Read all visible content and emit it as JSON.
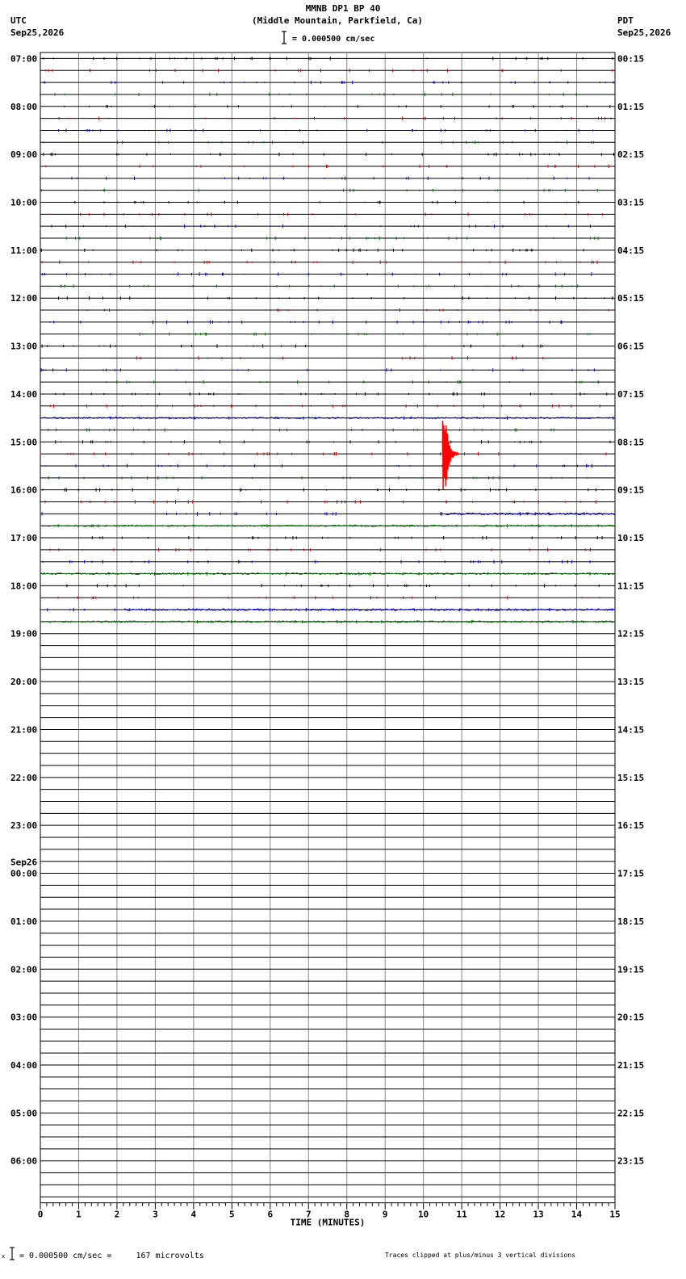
{
  "header": {
    "title": "MMNB DP1 BP 40",
    "subtitle": "(Middle Mountain, Parkfield, Ca)",
    "scale_label": "= 0.000500 cm/sec",
    "left_tz": "UTC",
    "left_date": "Sep25,2026",
    "right_tz": "PDT",
    "right_date": "Sep25,2026"
  },
  "footer": {
    "scale_note": "= 0.000500 cm/sec =     167 microvolts",
    "clip_note": "Traces clipped at plus/minus 3 vertical divisions"
  },
  "chart_data": {
    "type": "line",
    "title": "MMNB DP1 BP 40",
    "xlabel": "TIME (MINUTES)",
    "xlim": [
      0,
      15
    ],
    "x_ticks": [
      "0",
      "1",
      "2",
      "3",
      "4",
      "5",
      "6",
      "7",
      "8",
      "9",
      "10",
      "11",
      "12",
      "13",
      "14",
      "15"
    ],
    "traces_per_hour": 4,
    "total_traces": 96,
    "active_traces": 48,
    "trace_colors": [
      "#000000",
      "#cc0000",
      "#0000cc",
      "#007700"
    ],
    "left_labels": [
      {
        "trace": 0,
        "text": "07:00"
      },
      {
        "trace": 4,
        "text": "08:00"
      },
      {
        "trace": 8,
        "text": "09:00"
      },
      {
        "trace": 12,
        "text": "10:00"
      },
      {
        "trace": 16,
        "text": "11:00"
      },
      {
        "trace": 20,
        "text": "12:00"
      },
      {
        "trace": 24,
        "text": "13:00"
      },
      {
        "trace": 28,
        "text": "14:00"
      },
      {
        "trace": 32,
        "text": "15:00"
      },
      {
        "trace": 36,
        "text": "16:00"
      },
      {
        "trace": 40,
        "text": "17:00"
      },
      {
        "trace": 44,
        "text": "18:00"
      },
      {
        "trace": 48,
        "text": "19:00"
      },
      {
        "trace": 52,
        "text": "20:00"
      },
      {
        "trace": 56,
        "text": "21:00"
      },
      {
        "trace": 60,
        "text": "22:00"
      },
      {
        "trace": 64,
        "text": "23:00"
      },
      {
        "trace": 68,
        "text": "00:00",
        "date": "Sep26"
      },
      {
        "trace": 72,
        "text": "01:00"
      },
      {
        "trace": 76,
        "text": "02:00"
      },
      {
        "trace": 80,
        "text": "03:00"
      },
      {
        "trace": 84,
        "text": "04:00"
      },
      {
        "trace": 88,
        "text": "05:00"
      },
      {
        "trace": 92,
        "text": "06:00"
      }
    ],
    "right_labels": [
      "00:15",
      "01:15",
      "02:15",
      "03:15",
      "04:15",
      "05:15",
      "06:15",
      "07:15",
      "08:15",
      "09:15",
      "10:15",
      "11:15",
      "12:15",
      "13:15",
      "14:15",
      "15:15",
      "16:15",
      "17:15",
      "18:15",
      "19:15",
      "20:15",
      "21:15",
      "22:15",
      "23:15"
    ],
    "noisy_traces": [
      {
        "trace": 30,
        "start_min": 0,
        "level": 0.8
      },
      {
        "trace": 38,
        "start_min": 10.6,
        "level": 1.2
      },
      {
        "trace": 39,
        "start_min": 0,
        "level": 0.9
      },
      {
        "trace": 43,
        "start_min": 0,
        "level": 1.0
      },
      {
        "trace": 46,
        "start_min": 2.2,
        "level": 1.1
      },
      {
        "trace": 47,
        "start_min": 0,
        "level": 1.0
      }
    ],
    "events": [
      {
        "trace": 33,
        "minute": 10.5,
        "amplitude_divisions": 3,
        "color": "#ff0000",
        "clipped": true
      }
    ],
    "clip_divisions": 3
  }
}
